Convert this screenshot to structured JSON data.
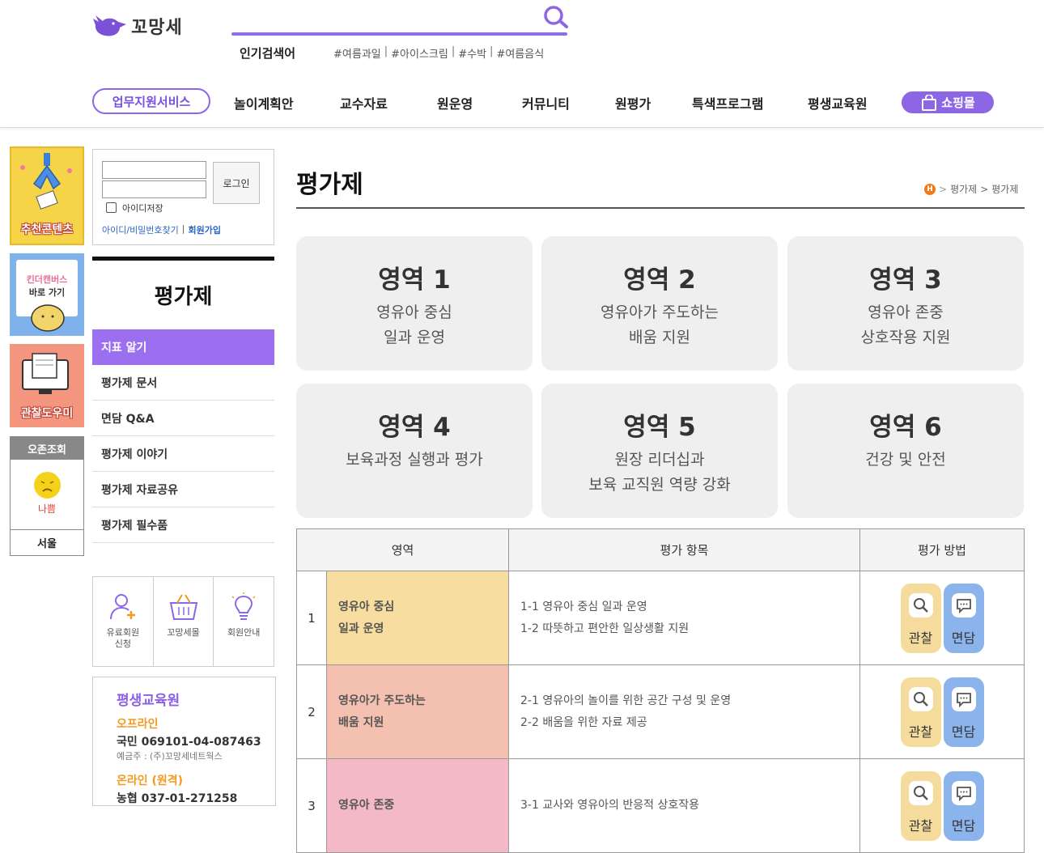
{
  "header": {
    "logo_text": "꼬망세",
    "popular_label": "인기검색어",
    "popular_tags": [
      "#여름과일",
      "#아이스크림",
      "#수박",
      "#여름음식"
    ]
  },
  "gnb": {
    "work_service": "업무지원서비스",
    "items": [
      "놀이계획안",
      "교수자료",
      "원운영",
      "커뮤니티",
      "원평가",
      "특색프로그램",
      "평생교육원"
    ],
    "shop": "쇼핑몰"
  },
  "banners": {
    "recommended": "추천콘텐츠",
    "kinder_canvas_1": "킨더캔버스",
    "kinder_canvas_2": "바로 가기",
    "observation": "관찰도우미"
  },
  "weather": {
    "title": "오존조회",
    "status": "나쁨",
    "city": "서울"
  },
  "login": {
    "button": "로그인",
    "remember": "아이디저장",
    "find": "아이디/비밀번호찾기",
    "join": "회원가입"
  },
  "sidemenu": {
    "title": "평가제",
    "items": [
      "지표 알기",
      "평가제 문서",
      "면담 Q&A",
      "평가제 이야기",
      "평가제 자료공유",
      "평가제 필수품"
    ]
  },
  "quick": {
    "paid_member_1": "유료회원",
    "paid_member_2": "신청",
    "shop": "꼬망세몰",
    "info": "회원안내"
  },
  "edu": {
    "title": "평생교육원",
    "offline": "오프라인",
    "offline_account": "국민 069101-04-087463",
    "depositor": "예금주 : (주)꼬망세네트웍스",
    "online": "온라인 (원격)",
    "online_account": "농협 037-01-271258"
  },
  "main": {
    "title": "평가제",
    "breadcrumb": [
      "평가제",
      "평가제"
    ],
    "breadcrumb_sep": ">",
    "home_badge": "H"
  },
  "cards": [
    {
      "num": "영역 1",
      "line1": "영유아 중심",
      "line2": "일과 운영"
    },
    {
      "num": "영역 2",
      "line1": "영유아가 주도하는",
      "line2": "배움 지원"
    },
    {
      "num": "영역 3",
      "line1": "영유아 존중",
      "line2": "상호작용 지원"
    },
    {
      "num": "영역 4",
      "line1": "보육과정 실행과 평가",
      "line2": ""
    },
    {
      "num": "영역 5",
      "line1": "원장 리더십과",
      "line2": "보육 교직원 역량 강화"
    },
    {
      "num": "영역 6",
      "line1": "건강 및 안전",
      "line2": ""
    }
  ],
  "table": {
    "headers": [
      "영역",
      "평가 항목",
      "평가 방법"
    ],
    "method_obs": "관찰",
    "method_int": "면담",
    "rows": [
      {
        "no": "1",
        "area1": "영유아 중심",
        "area2": "일과 운영",
        "item1": "1-1 영유아 중심 일과 운영",
        "item2": "1-2 따뜻하고 편안한 일상생활 지원",
        "color": "#f8dda0"
      },
      {
        "no": "2",
        "area1": "영유아가 주도하는",
        "area2": "배움 지원",
        "item1": "2-1 영유아의 놀이를 위한 공간 구성 및 운영",
        "item2": "2-2 배움을 위한 자료 제공",
        "color": "#f4c1b0"
      },
      {
        "no": "3",
        "area1": "영유아 존중",
        "area2": "",
        "item1": "3-1 교사와 영유아의 반응적 상호작용",
        "item2": "",
        "color": "#f3b9c7"
      }
    ]
  },
  "colors": {
    "accent": "#8d66e6",
    "menu_active": "#9b6ff0"
  }
}
